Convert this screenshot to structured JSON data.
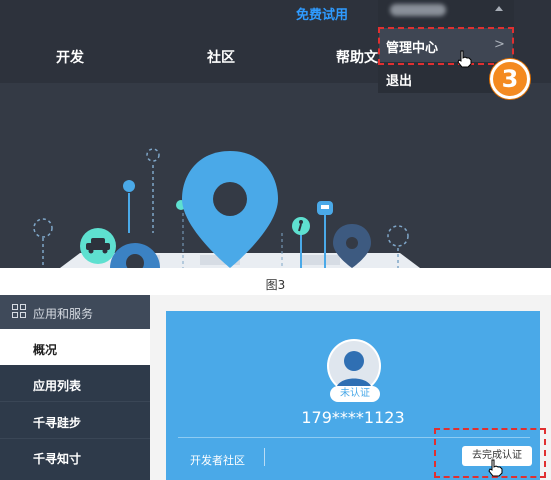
{
  "top_screenshot": {
    "header": {
      "free_trial": "免费试用",
      "nav": [
        "开发",
        "社区",
        "帮助文"
      ]
    },
    "user_menu": {
      "items": [
        "管理中心",
        "退出"
      ],
      "arrow": ">"
    },
    "step_number": "3"
  },
  "caption": "图3",
  "bottom_screenshot": {
    "sidebar": {
      "header": "应用和服务",
      "items": [
        "概况",
        "应用列表",
        "千寻跬步",
        "千寻知寸"
      ]
    },
    "card": {
      "status_badge": "未认证",
      "phone": "179****1123",
      "community_link": "开发者社区",
      "certify_button": "去完成认证"
    }
  },
  "colors": {
    "dark_bg": "#343a45",
    "accent_blue": "#2f9bff",
    "card_blue": "#4aa9e8",
    "highlight_red": "#e03030",
    "badge_orange": "#f48a20"
  }
}
